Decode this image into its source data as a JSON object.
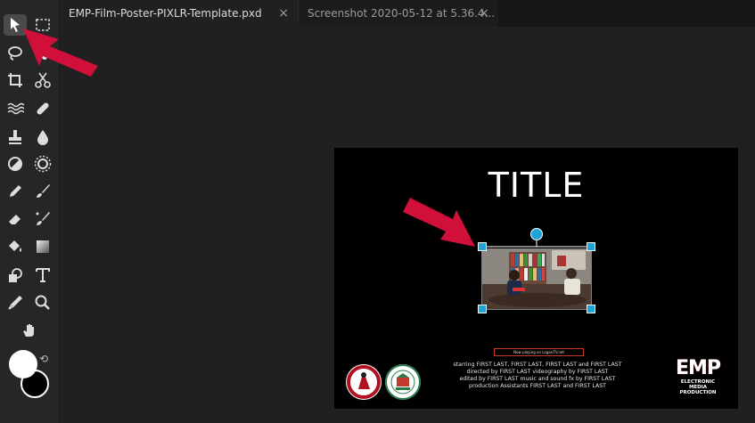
{
  "tabs": [
    {
      "label": "EMP-Film-Poster-PIXLR-Template.pxd",
      "close": "×",
      "active": true
    },
    {
      "label": "Screenshot 2020-05-12 at 5.36.4...",
      "close": "×",
      "active": false
    }
  ],
  "tools": [
    {
      "name": "move-tool",
      "icon": "arrow-pointer-icon"
    },
    {
      "name": "marquee-tool",
      "icon": "marquee-icon"
    },
    {
      "name": "lasso-tool",
      "icon": "lasso-icon"
    },
    {
      "name": "quick-select-tool",
      "icon": "wand-icon"
    },
    {
      "name": "crop-tool",
      "icon": "crop-icon"
    },
    {
      "name": "cutout-tool",
      "icon": "scissors-icon"
    },
    {
      "name": "liquify-tool",
      "icon": "wave-icon"
    },
    {
      "name": "heal-tool",
      "icon": "bandage-icon"
    },
    {
      "name": "clone-stamp-tool",
      "icon": "stamp-icon"
    },
    {
      "name": "blur-tool",
      "icon": "drop-icon"
    },
    {
      "name": "dodge-tool",
      "icon": "dodge-icon"
    },
    {
      "name": "sponge-tool",
      "icon": "sun-icon"
    },
    {
      "name": "pencil-tool",
      "icon": "pencil-icon"
    },
    {
      "name": "brush-tool",
      "icon": "brush-icon"
    },
    {
      "name": "eraser-tool",
      "icon": "eraser-icon"
    },
    {
      "name": "color-replace-tool",
      "icon": "color-replace-icon"
    },
    {
      "name": "fill-tool",
      "icon": "bucket-icon"
    },
    {
      "name": "gradient-tool",
      "icon": "gradient-icon"
    },
    {
      "name": "shape-tool",
      "icon": "shapes-icon"
    },
    {
      "name": "text-tool",
      "icon": "text-icon"
    },
    {
      "name": "color-picker-tool",
      "icon": "eyedropper-icon"
    },
    {
      "name": "zoom-tool",
      "icon": "magnifier-icon"
    },
    {
      "name": "hand-tool",
      "icon": "hand-icon"
    }
  ],
  "poster": {
    "title": "TITLE",
    "now_playing": "Now playing on LoganTV.net",
    "credits": [
      "starring FIRST LAST, FIRST LAST, FIRST LAST and FIRST LAST",
      "directed by FIRST LAST videography by FIRST LAST",
      "edited by FIRST LAST music and sound fx by FIRST LAST",
      "production Assistants FIRST LAST and FIRST LAST"
    ],
    "emp_logo": "EMP",
    "emp_sub1": "ELECTRONIC MEDIA",
    "emp_sub2": "PRODUCTION"
  },
  "colors": {
    "accent": "#1fa3d8",
    "arrow": "#d0103a",
    "foreground": "#ffffff",
    "background": "#000000"
  }
}
